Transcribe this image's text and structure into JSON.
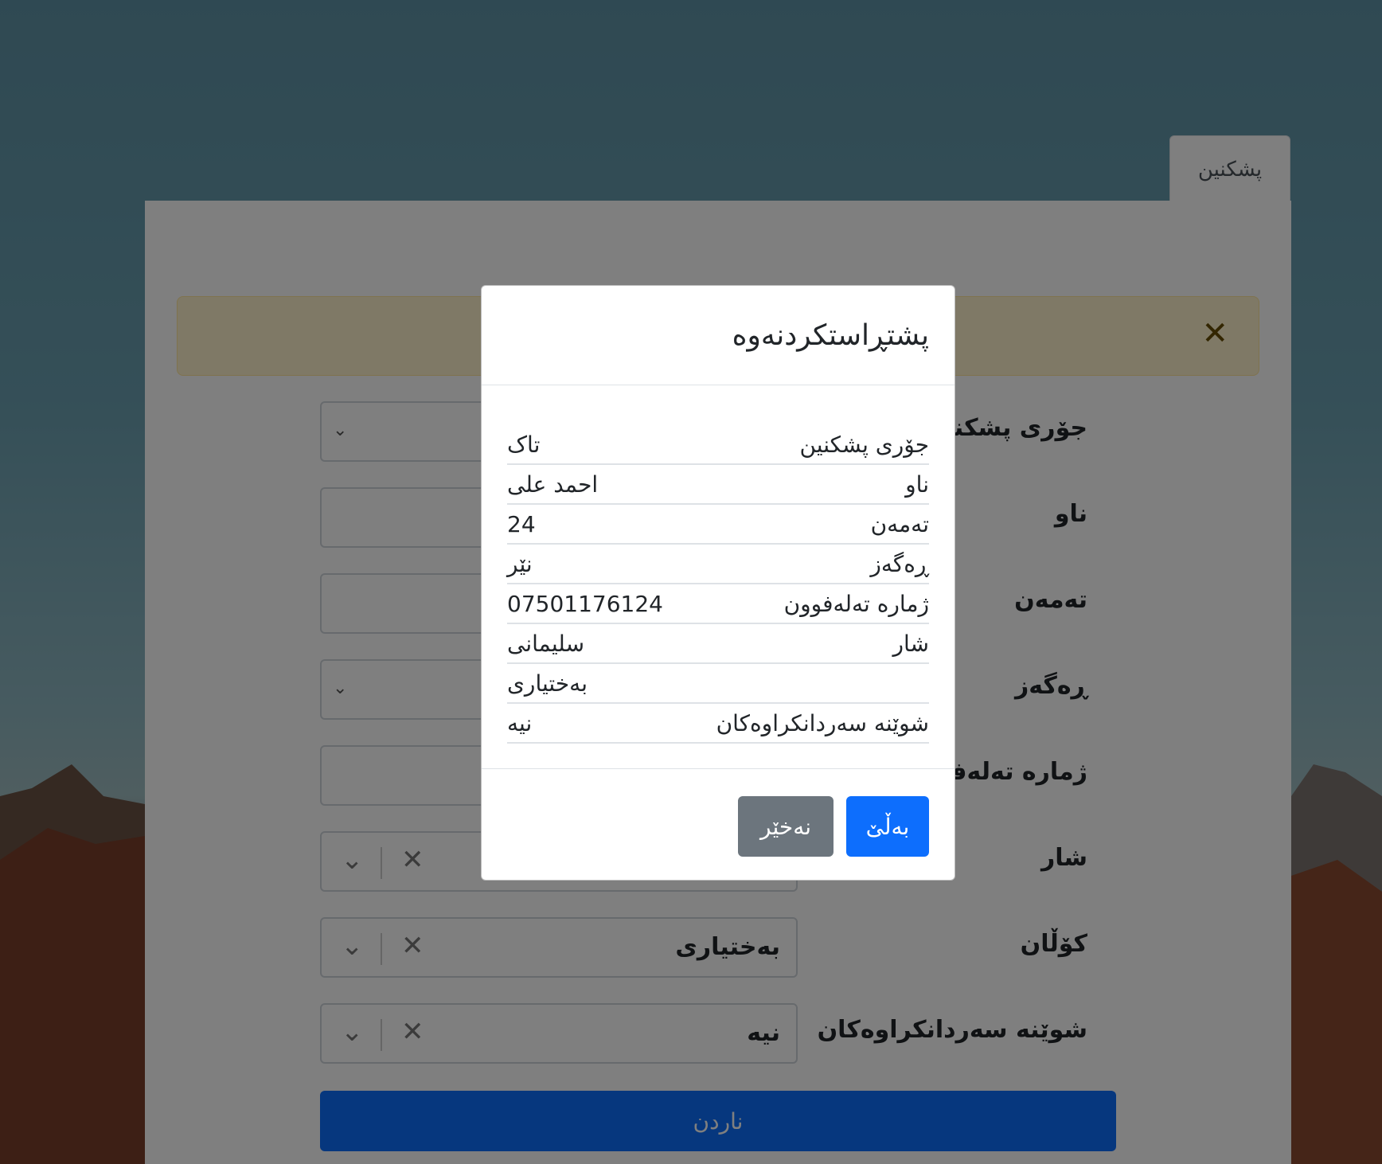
{
  "tab": {
    "label": "پشکنین"
  },
  "form": {
    "fields": [
      {
        "label": "جۆری پشکنین",
        "value": ""
      },
      {
        "label": "ناو",
        "value": ""
      },
      {
        "label": "تەمەن",
        "value": ""
      },
      {
        "label": "ڕەگەز",
        "value": ""
      },
      {
        "label": "ژمارە تەلەفوون",
        "value": ""
      },
      {
        "label": "شار",
        "value": ""
      },
      {
        "label": "کۆڵان",
        "value": "بەختیاری"
      },
      {
        "label": "شوێنە سەردانکراوەکان",
        "value": "نیە"
      }
    ],
    "submit_label": "ناردن"
  },
  "modal": {
    "title": "پشتڕاستکردنەوە",
    "rows": [
      {
        "key": "جۆری پشکنین",
        "value": "تاک"
      },
      {
        "key": "ناو",
        "value": "احمد علی"
      },
      {
        "key": "تەمەن",
        "value": "24"
      },
      {
        "key": "ڕەگەز",
        "value": "نێر"
      },
      {
        "key": "ژمارە تەلەفوون",
        "value": "07501176124"
      },
      {
        "key": "شار",
        "value": "سلیمانی"
      },
      {
        "key": "",
        "value": "بەختیاری"
      },
      {
        "key": "شوێنە سەردانکراوەکان",
        "value": "نیە"
      }
    ],
    "yes_label": "بەڵێ",
    "no_label": "نەخێر"
  },
  "colors": {
    "primary": "#0d6efd",
    "secondary": "#6c757d",
    "alert_bg": "#fff3cd"
  }
}
